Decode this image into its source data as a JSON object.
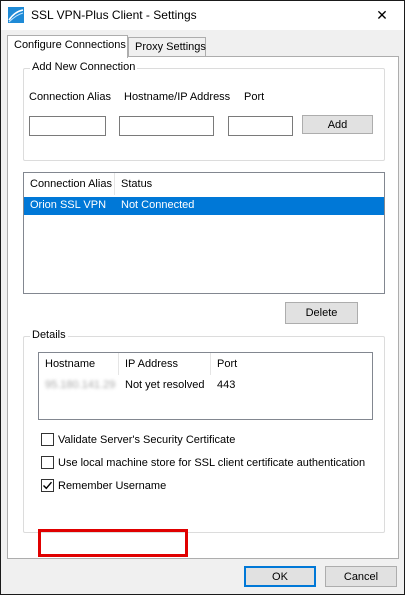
{
  "window": {
    "title": "SSL VPN-Plus Client - Settings",
    "close_glyph": "✕"
  },
  "tabs": [
    {
      "label": "Configure Connections",
      "active": true
    },
    {
      "label": "Proxy Settings",
      "active": false
    }
  ],
  "add_connection": {
    "group_label": "Add New Connection",
    "alias_label": "Connection Alias",
    "alias_value": "",
    "hostname_label": "Hostname/IP Address",
    "hostname_value": "",
    "port_label": "Port",
    "port_value": "",
    "add_button": "Add"
  },
  "connections": {
    "columns": [
      "Connection Alias",
      "Status"
    ],
    "rows": [
      {
        "alias": "Orion SSL VPN",
        "status": "Not Connected",
        "selected": true
      }
    ],
    "delete_button": "Delete"
  },
  "details": {
    "group_label": "Details",
    "columns": [
      "Hostname",
      "IP Address",
      "Port"
    ],
    "rows": [
      {
        "hostname": "95.180.141.29",
        "ip": "Not yet resolved",
        "port": "443"
      }
    ],
    "options": [
      {
        "label": "Validate Server's Security Certificate",
        "checked": false
      },
      {
        "label": "Use local machine store for SSL client certificate authentication",
        "checked": false
      },
      {
        "label": "Remember Username",
        "checked": true
      }
    ]
  },
  "footer": {
    "ok_button": "OK",
    "cancel_button": "Cancel"
  },
  "colors": {
    "selection": "#0078d7",
    "highlight_box": "#e00000"
  }
}
